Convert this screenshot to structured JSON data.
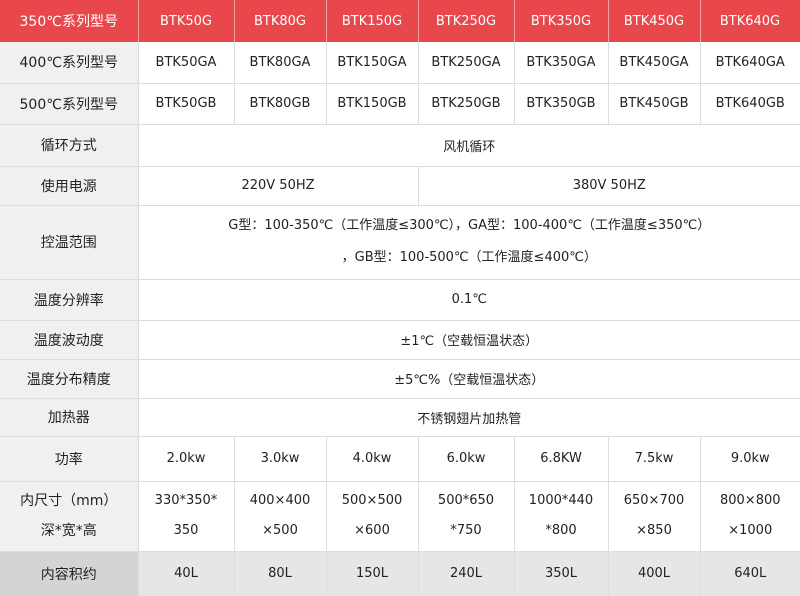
{
  "header": {
    "label": "350℃系列型号",
    "models": [
      "BTK50G",
      "BTK80G",
      "BTK150G",
      "BTK250G",
      "BTK350G",
      "BTK450G",
      "BTK640G"
    ]
  },
  "row_400": {
    "label": "400℃系列型号",
    "models": [
      "BTK50GA",
      "BTK80GA",
      "BTK150GA",
      "BTK250GA",
      "BTK350GA",
      "BTK450GA",
      "BTK640GA"
    ]
  },
  "row_500": {
    "label": "500℃系列型号",
    "models": [
      "BTK50GB",
      "BTK80GB",
      "BTK150GB",
      "BTK250GB",
      "BTK350GB",
      "BTK450GB",
      "BTK640GB"
    ]
  },
  "circulation": {
    "label": "循环方式",
    "value": "风机循环"
  },
  "power_supply": {
    "label": "使用电源",
    "left": "220V 50HZ",
    "right": "380V 50HZ"
  },
  "temp_range": {
    "label": "控温范围",
    "line1": "G型：100-350℃（工作温度≤300℃），GA型：100-400℃（工作温度≤350℃）",
    "line2": "，GB型：100-500℃（工作温度≤400℃）"
  },
  "resolution": {
    "label": "温度分辨率",
    "value": "0.1℃"
  },
  "fluctuation": {
    "label": "温度波动度",
    "value": "±1℃（空载恒温状态）"
  },
  "uniformity": {
    "label": "温度分布精度",
    "value": "±5℃%（空载恒温状态）"
  },
  "heater": {
    "label": "加热器",
    "value": "不锈钢翅片加热管"
  },
  "power": {
    "label": "功率",
    "values": [
      "2.0kw",
      "3.0kw",
      "4.0kw",
      "6.0kw",
      "6.8KW",
      "7.5kw",
      "9.0kw"
    ]
  },
  "inner_size": {
    "label_line1": "内尺寸（mm）",
    "label_line2": "深*宽*高",
    "values": [
      [
        "330*350*",
        "350"
      ],
      [
        "400×400",
        "×500"
      ],
      [
        "500×500",
        "×600"
      ],
      [
        "500*650",
        "*750"
      ],
      [
        "1000*440",
        "*800"
      ],
      [
        "650×700",
        "×850"
      ],
      [
        "800×800",
        "×1000"
      ]
    ]
  },
  "volume": {
    "label": "内容积约",
    "values": [
      "40L",
      "80L",
      "150L",
      "240L",
      "350L",
      "400L",
      "640L"
    ]
  }
}
